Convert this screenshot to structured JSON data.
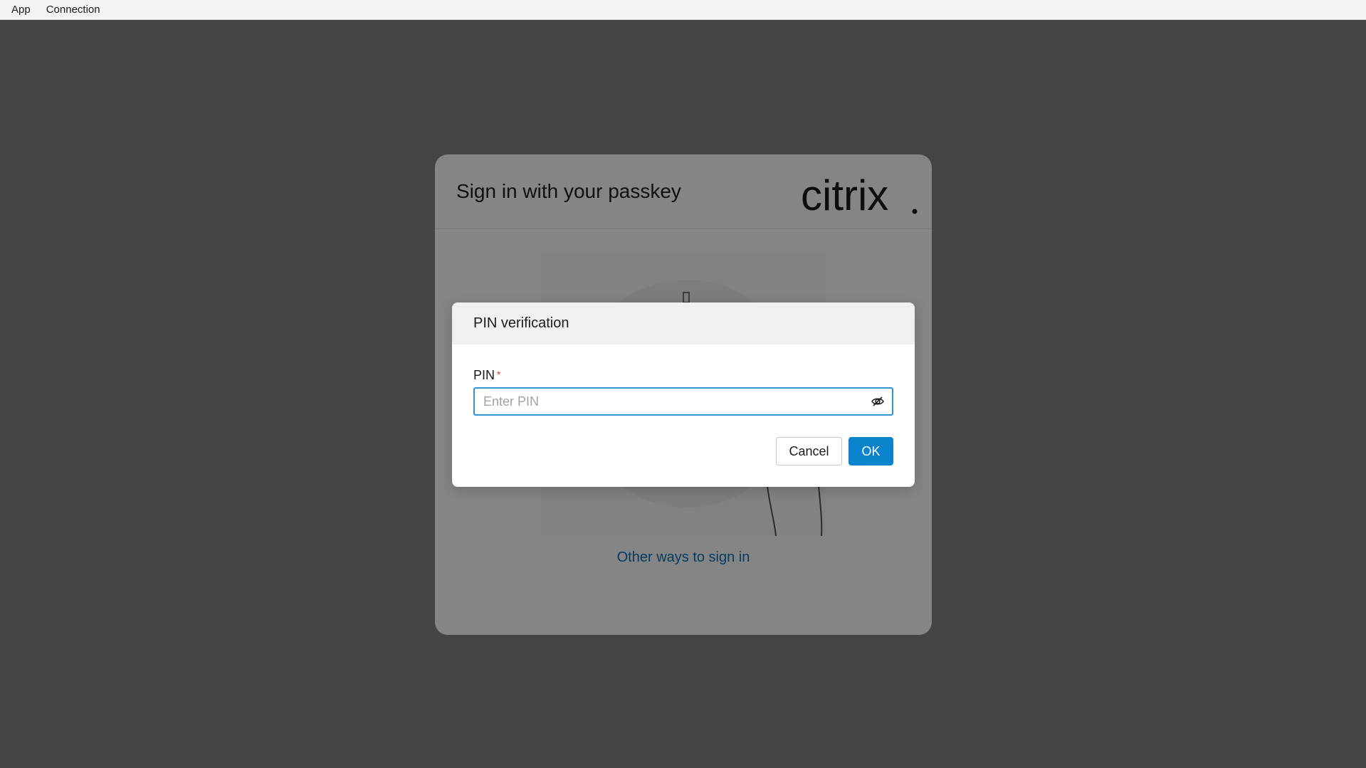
{
  "menubar": {
    "items": [
      {
        "label": "App"
      },
      {
        "label": "Connection"
      }
    ]
  },
  "signin_page": {
    "title": "Sign in with your passkey",
    "logo_text": "citrix",
    "other_ways_link": "Other ways to sign in"
  },
  "pin_dialog": {
    "title": "PIN verification",
    "field_label": "PIN",
    "required_mark": "*",
    "input_value": "",
    "input_placeholder": "Enter PIN",
    "toggle_icon": "eye-slash-icon",
    "cancel_label": "Cancel",
    "ok_label": "OK"
  },
  "colors": {
    "accent": "#0a84cc",
    "link": "#0b72b8",
    "required": "#e0413a",
    "focus_border": "#2f96d6"
  }
}
